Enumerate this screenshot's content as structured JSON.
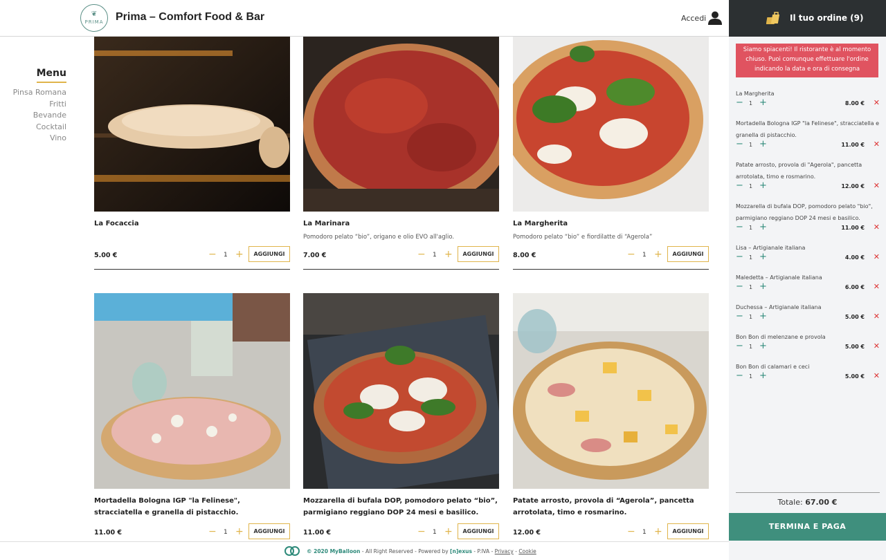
{
  "header": {
    "brand": "Prima – Comfort Food & Bar",
    "logo_text": "PRIMA",
    "login_label": "Accedi"
  },
  "order_header": {
    "title": "Il tuo ordine (9)"
  },
  "menu": {
    "title": "Menu",
    "items": [
      "Pinsa Romana",
      "Fritti",
      "Bevande",
      "Cocktail",
      "Vino"
    ]
  },
  "products": [
    {
      "name": "La Focaccia",
      "desc": "",
      "price": "5.00 €",
      "qty": "1",
      "add": "AGGIUNGI"
    },
    {
      "name": "La Marinara",
      "desc": "Pomodoro pelato “bio”, origano e olio EVO all'aglio.",
      "price": "7.00 €",
      "qty": "1",
      "add": "AGGIUNGI"
    },
    {
      "name": "La Margherita",
      "desc": "Pomodoro pelato “bio” e fiordilatte di “Agerola”",
      "price": "8.00 €",
      "qty": "1",
      "add": "AGGIUNGI"
    },
    {
      "name": "Mortadella Bologna IGP \"la Felinese\", stracciatella e granella di pistacchio.",
      "desc": "",
      "price": "11.00 €",
      "qty": "1",
      "add": "AGGIUNGI"
    },
    {
      "name": "Mozzarella di bufala DOP, pomodoro pelato “bio”, parmigiano reggiano DOP 24 mesi e basilico.",
      "desc": "",
      "price": "11.00 €",
      "qty": "1",
      "add": "AGGIUNGI"
    },
    {
      "name": "Patate arrosto, provola di “Agerola”, pancetta arrotolata, timo e rosmarino.",
      "desc": "",
      "price": "12.00 €",
      "qty": "1",
      "add": "AGGIUNGI"
    }
  ],
  "order": {
    "alert": "Siamo spiacenti! Il ristorante è al momento chiuso. Puoi comunque effettuare l'ordine indicando la data e ora di consegna",
    "items": [
      {
        "name": "La Margherita",
        "qty": "1",
        "price": "8.00 €"
      },
      {
        "name": "Mortadella Bologna IGP \"la Felinese\", stracciatella e granella di pistacchio.",
        "qty": "1",
        "price": "11.00 €"
      },
      {
        "name": "Patate arrosto, provola di \"Agerola\", pancetta arrotolata, timo e rosmarino.",
        "qty": "1",
        "price": "12.00 €"
      },
      {
        "name": "Mozzarella di bufala DOP, pomodoro pelato \"bio\", parmigiano reggiano DOP 24 mesi e basilico.",
        "qty": "1",
        "price": "11.00 €"
      },
      {
        "name": "Lisa – Artigianale italiana",
        "qty": "1",
        "price": "4.00 €"
      },
      {
        "name": "Maledetta – Artigianale italiana",
        "qty": "1",
        "price": "6.00 €"
      },
      {
        "name": "Duchessa – Artigianale italiana",
        "qty": "1",
        "price": "5.00 €"
      },
      {
        "name": "Bon Bon di melenzane e provola",
        "qty": "1",
        "price": "5.00 €"
      },
      {
        "name": "Bon Bon di calamari e ceci",
        "qty": "1",
        "price": "5.00 €"
      }
    ],
    "total_label": "Totale:",
    "total_value": "67.00 €",
    "pay_label": "TERMINA E PAGA"
  },
  "footer": {
    "copyright": "© 2020 MyBalloon",
    "rights": " - All Right Reserved - Powered by ",
    "powered": "[n]exus",
    "piva": " - P.IVA - ",
    "privacy": "Privacy",
    "sep": " - ",
    "cookie": "Cookie"
  },
  "colors": {
    "accent": "#e0b44a",
    "teal": "#3f8f7d",
    "alert": "#e05360",
    "dark": "#2c3032"
  }
}
